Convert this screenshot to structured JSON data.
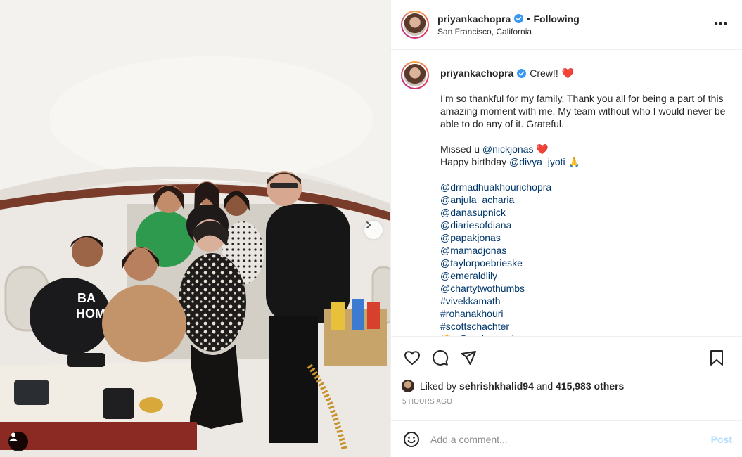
{
  "photo": {
    "carousel_dots": 7,
    "active_dot": 0,
    "next_icon": "chevron-right-icon",
    "user_tag_icon": "user-icon"
  },
  "header": {
    "username": "priyankachopra",
    "separator": "•",
    "follow_status": "Following",
    "location": "San Francisco, California",
    "more_label": "•••"
  },
  "caption": {
    "username": "priyankachopra",
    "title": "Crew!!",
    "title_emoji": "❤️",
    "body": "I’m so thankful for my family. Thank you all for being a part of this amazing moment with me. My team without who I would never be able to do any of it. Grateful.",
    "missed_prefix": "Missed u",
    "missed_mention": "@nickjonas",
    "missed_emoji": "❤️",
    "birthday_prefix": "Happy birthday",
    "birthday_mention": "@divya_jyoti",
    "birthday_emoji": "🙏",
    "mentions": [
      "@drmadhuakhourichopra",
      "@anjula_acharia",
      "@danasupnick",
      "@diariesofdiana",
      "@papakjonas",
      "@mamadjonas",
      "@taylorpoebrieske",
      "@emeraldlily__",
      "@chartytwothumbs",
      "#vivekkamath",
      "#rohanakhouri",
      "#scottschachter",
      "📸: @amberasaly"
    ]
  },
  "likes": {
    "prefix": "Liked by",
    "user": "sehrishkhalid94",
    "conjunction": "and",
    "others": "415,983 others"
  },
  "timestamp": "5 HOURS AGO",
  "comment_box": {
    "placeholder": "Add a comment...",
    "post_label": "Post"
  },
  "colors": {
    "link": "#00376b",
    "verified": "#3897f0",
    "post_disabled": "#b2dffc",
    "muted": "#8e8e8e"
  }
}
